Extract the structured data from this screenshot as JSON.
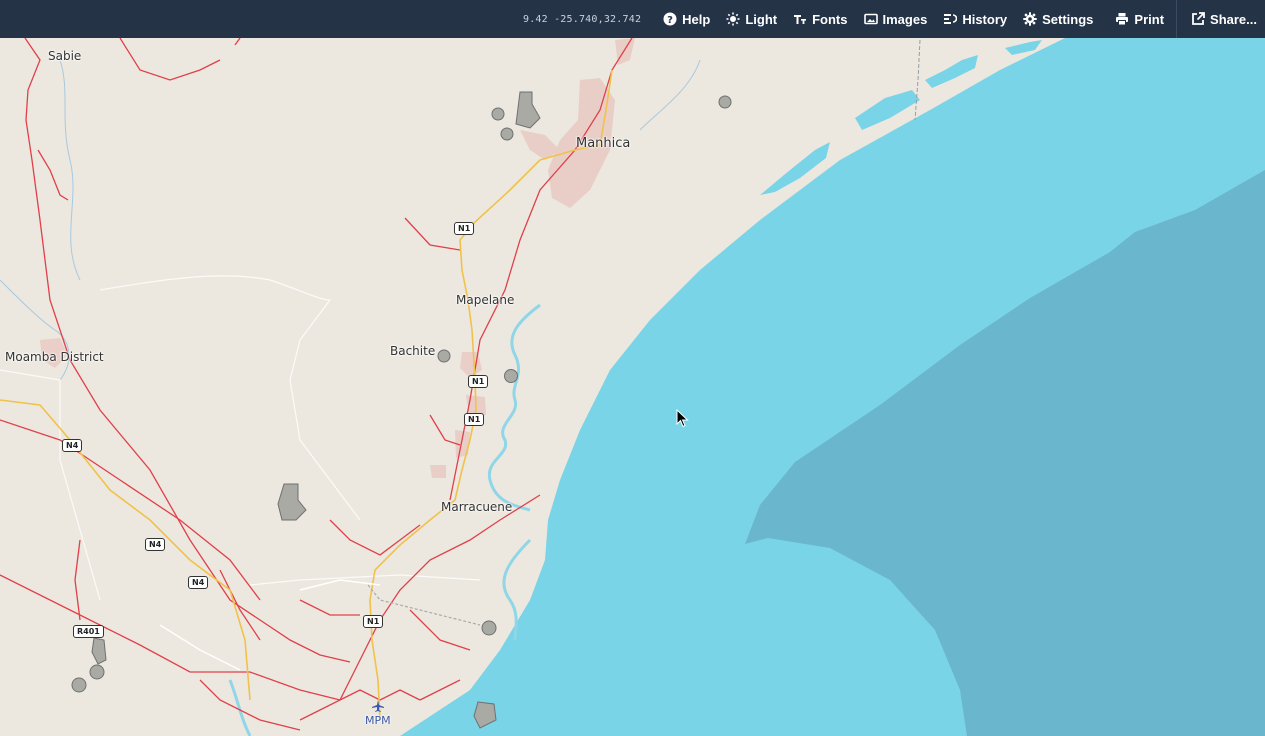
{
  "toolbar": {
    "coords": "9.42 -25.740,32.742",
    "buttons": [
      {
        "label": "Help",
        "icon": "help-icon"
      },
      {
        "label": "Light",
        "icon": "sun-icon"
      },
      {
        "label": "Fonts",
        "icon": "fonts-icon"
      },
      {
        "label": "Images",
        "icon": "image-icon"
      },
      {
        "label": "History",
        "icon": "history-icon"
      },
      {
        "label": "Settings",
        "icon": "gear-icon"
      },
      {
        "label": "Print",
        "icon": "print-icon"
      },
      {
        "label": "Share...",
        "icon": "share-icon"
      }
    ]
  },
  "map": {
    "places": {
      "sabie": "Sabie",
      "manhica": "Manhica",
      "mapelane": "Mapelane",
      "moamba": "Moamba District",
      "bachite": "Bachite",
      "marracuene": "Marracuene"
    },
    "shields": {
      "n1_a": "N1",
      "n1_b": "N1",
      "n1_c": "N1",
      "n1_d": "N1",
      "n4_a": "N4",
      "n4_b": "N4",
      "n4_c": "N4",
      "r401": "R401"
    },
    "airport": "MPM",
    "colors": {
      "land": "#ece8df",
      "sea": "#78d4e8",
      "deep_sea": "#6ab6cc",
      "road": "#e0404a",
      "highway": "#f0c24a",
      "river": "#8fd6e8",
      "toolbar": "#253347"
    }
  }
}
